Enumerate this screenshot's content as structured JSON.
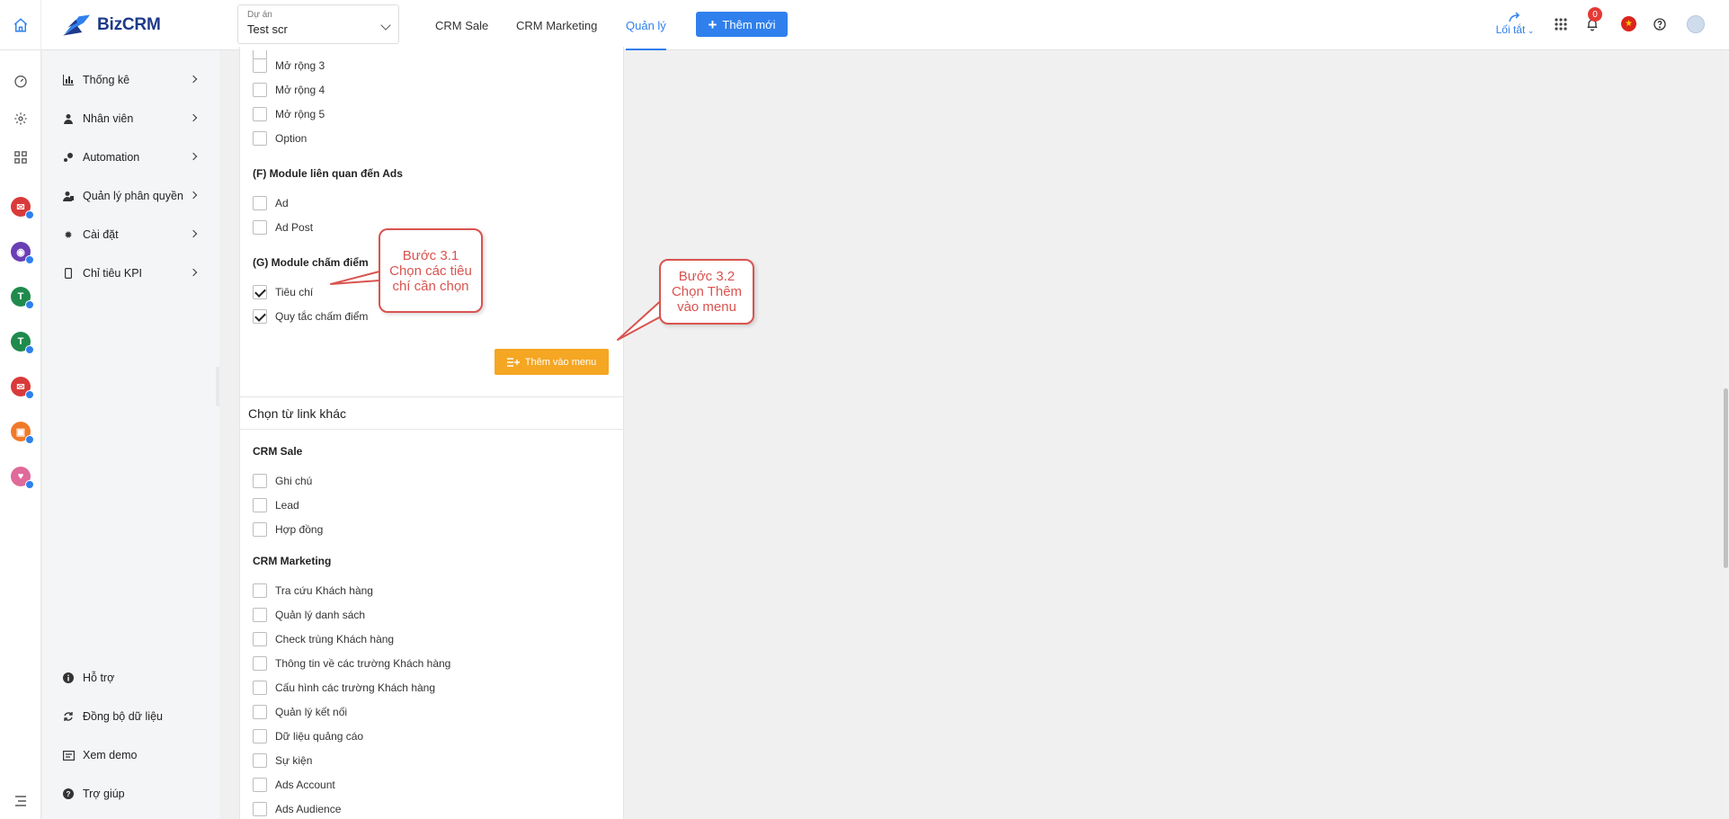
{
  "header": {
    "logo_text_a": "Biz",
    "logo_text_b": "CRM",
    "project_label": "Dự án",
    "project_value": "Test scr",
    "nav": [
      "CRM Sale",
      "CRM Marketing",
      "Quản lý"
    ],
    "active_nav": "Quản lý",
    "new_button": "Thêm mới",
    "shortcut": "Lối tắt",
    "notification_count": "0"
  },
  "sidebar": {
    "items": [
      "Thống kê",
      "Nhân viên",
      "Automation",
      "Quản lý phân quyền",
      "Cài đặt",
      "Chỉ tiêu KPI"
    ],
    "bottom_items": [
      "Hỗ trợ",
      "Đồng bộ dữ liệu",
      "Xem demo",
      "Trợ giúp"
    ]
  },
  "module_panel": {
    "expand_items": [
      "Mở rộng 3",
      "Mở rộng 4",
      "Mở rộng 5",
      "Option"
    ],
    "section_f": "(F) Module liên quan đến Ads",
    "section_f_items": [
      "Ad",
      "Ad Post"
    ],
    "section_g": "(G) Module chấm điểm",
    "section_g_items": [
      "Tiêu chí",
      "Quy tắc chấm điểm"
    ],
    "add_button": "Thêm vào menu"
  },
  "other_links_panel": {
    "title": "Chọn từ link khác",
    "crm_sale_title": "CRM Sale",
    "crm_sale_items": [
      "Ghi chú",
      "Lead",
      "Hợp đồng"
    ],
    "crm_marketing_title": "CRM Marketing",
    "crm_marketing_items": [
      "Tra cứu Khách hàng",
      "Quản lý danh sách",
      "Check trùng Khách hàng",
      "Thông tin về các trường Khách hàng",
      "Cấu hình các trường Khách hàng",
      "Quản lý kết nối",
      "Dữ liệu quảng cáo",
      "Sự kiện",
      "Ads Account",
      "Ads Audience"
    ]
  },
  "callouts": {
    "step31_title": "Bước 3.1",
    "step31_text": "Chọn các tiêu chí cần chọn",
    "step32_title": "Bước 3.2",
    "step32_text": "Chọn Thêm vào menu"
  },
  "colors": {
    "primary": "#2f80ed",
    "accent_orange": "#f5a623",
    "callout_red": "#d9534f"
  }
}
